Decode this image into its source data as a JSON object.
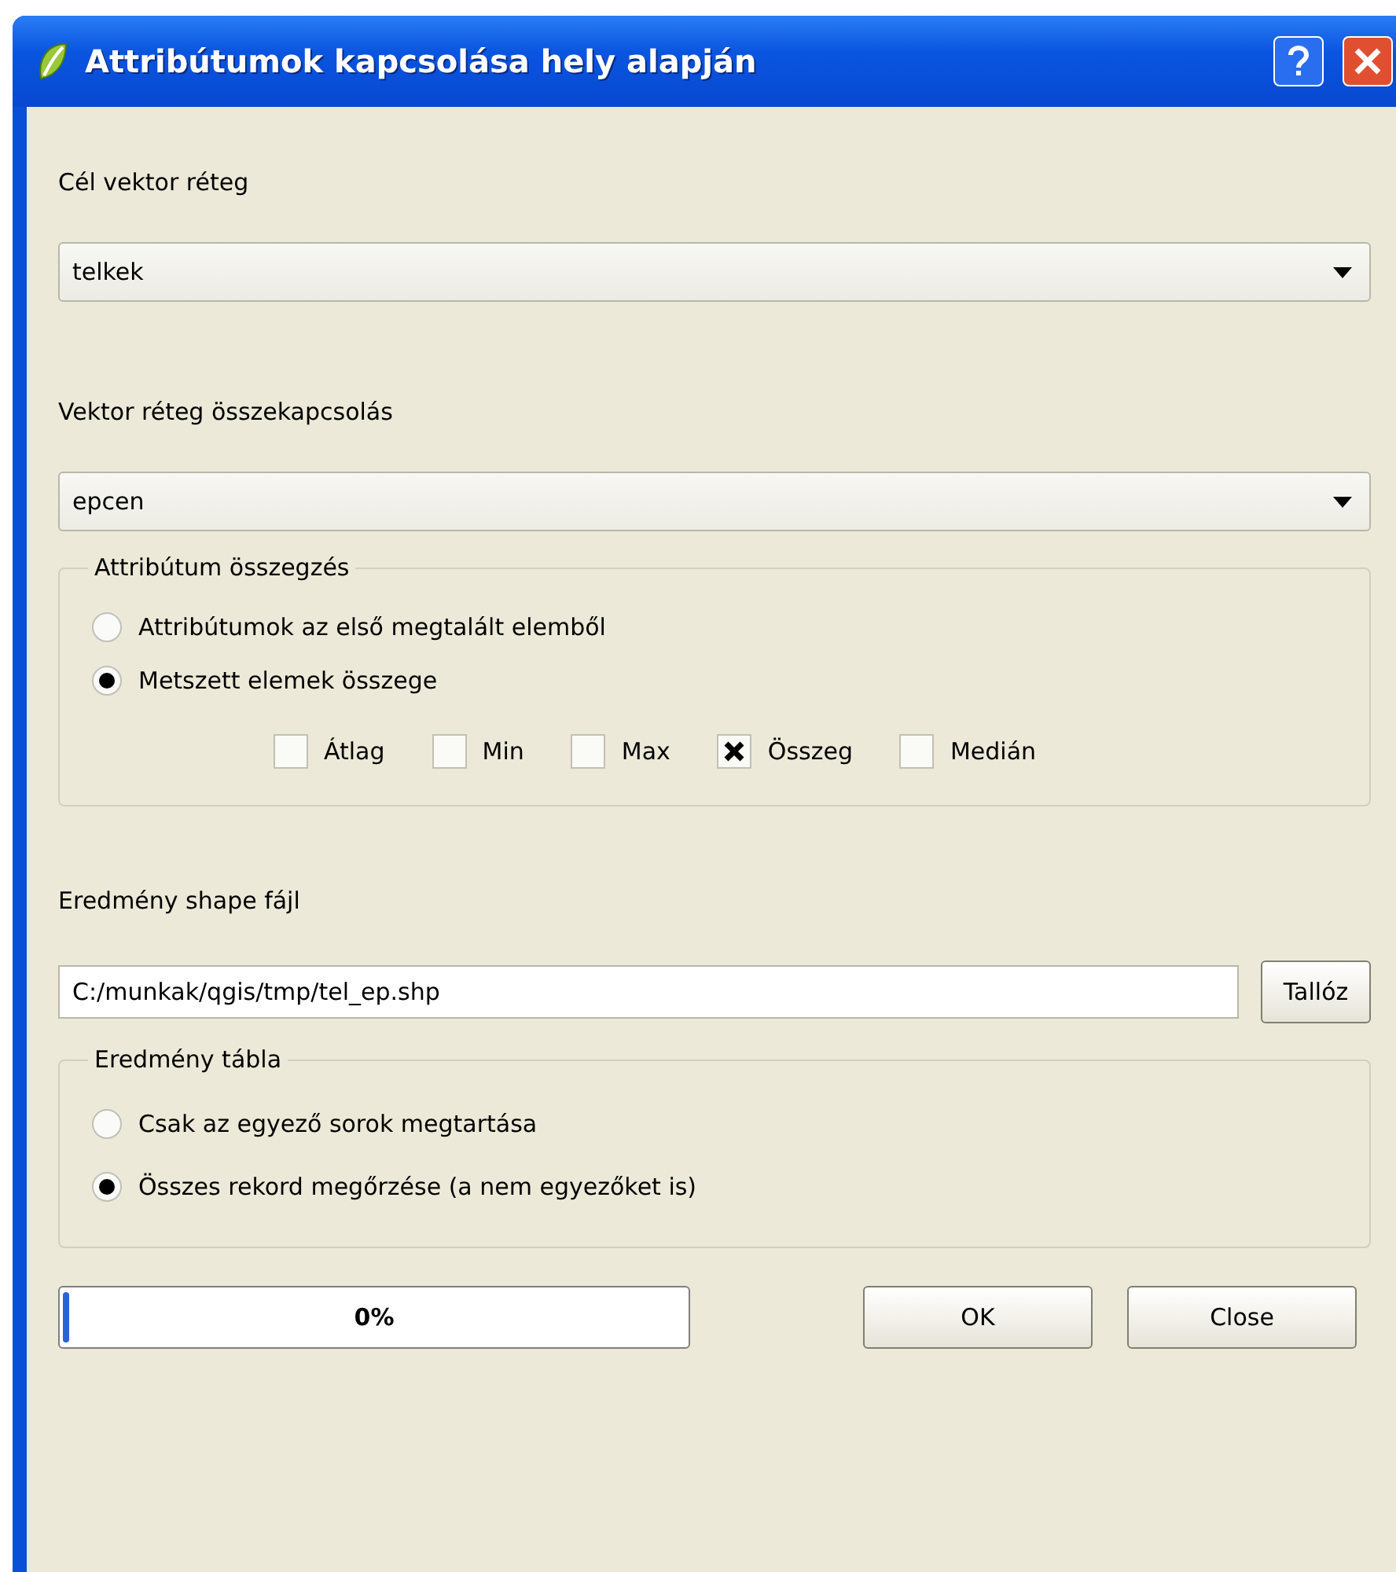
{
  "window": {
    "title": "Attribútumok kapcsolása hely alapján"
  },
  "target_layer": {
    "label": "Cél vektor réteg",
    "value": "telkek"
  },
  "join_layer": {
    "label": "Vektor réteg összekapcsolás",
    "value": "epcen"
  },
  "summary": {
    "title": "Attribútum összegzés",
    "options": [
      {
        "label": "Attribútumok az első megtalált elemből",
        "selected": false
      },
      {
        "label": "Metszett elemek összege",
        "selected": true
      }
    ],
    "statistics": [
      {
        "label": "Átlag",
        "checked": false
      },
      {
        "label": "Min",
        "checked": false
      },
      {
        "label": "Max",
        "checked": false
      },
      {
        "label": "Összeg",
        "checked": true
      },
      {
        "label": "Medián",
        "checked": false
      }
    ]
  },
  "output": {
    "label": "Eredmény shape fájl",
    "value": "C:/munkak/qgis/tmp/tel_ep.shp",
    "browse": "Tallóz"
  },
  "result_table": {
    "title": "Eredmény tábla",
    "options": [
      {
        "label": "Csak az egyező sorok megtartása",
        "selected": false
      },
      {
        "label": "Összes rekord megőrzése (a nem egyezőket is)",
        "selected": true
      }
    ]
  },
  "progress": {
    "level": 0.01,
    "text": "0%"
  },
  "buttons": [
    "OK",
    "Close"
  ]
}
